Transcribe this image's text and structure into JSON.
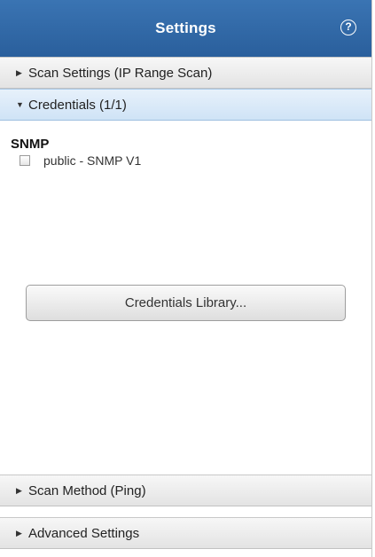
{
  "header": {
    "title": "Settings",
    "help_icon": "question-circle-icon",
    "color": "#2e67a6"
  },
  "sections": [
    {
      "label": "Scan Settings (IP Range Scan)",
      "expanded": false
    },
    {
      "label": "Credentials (1/1)",
      "expanded": true
    },
    {
      "label": "Scan Method (Ping)",
      "expanded": false
    },
    {
      "label": "Advanced Settings",
      "expanded": false
    }
  ],
  "credentials": {
    "group_title": "SNMP",
    "items": [
      {
        "label": "public - SNMP V1",
        "checked": false
      }
    ],
    "library_button": "Credentials Library..."
  },
  "arrows": {
    "collapsed": "▶",
    "expanded": "▼"
  }
}
